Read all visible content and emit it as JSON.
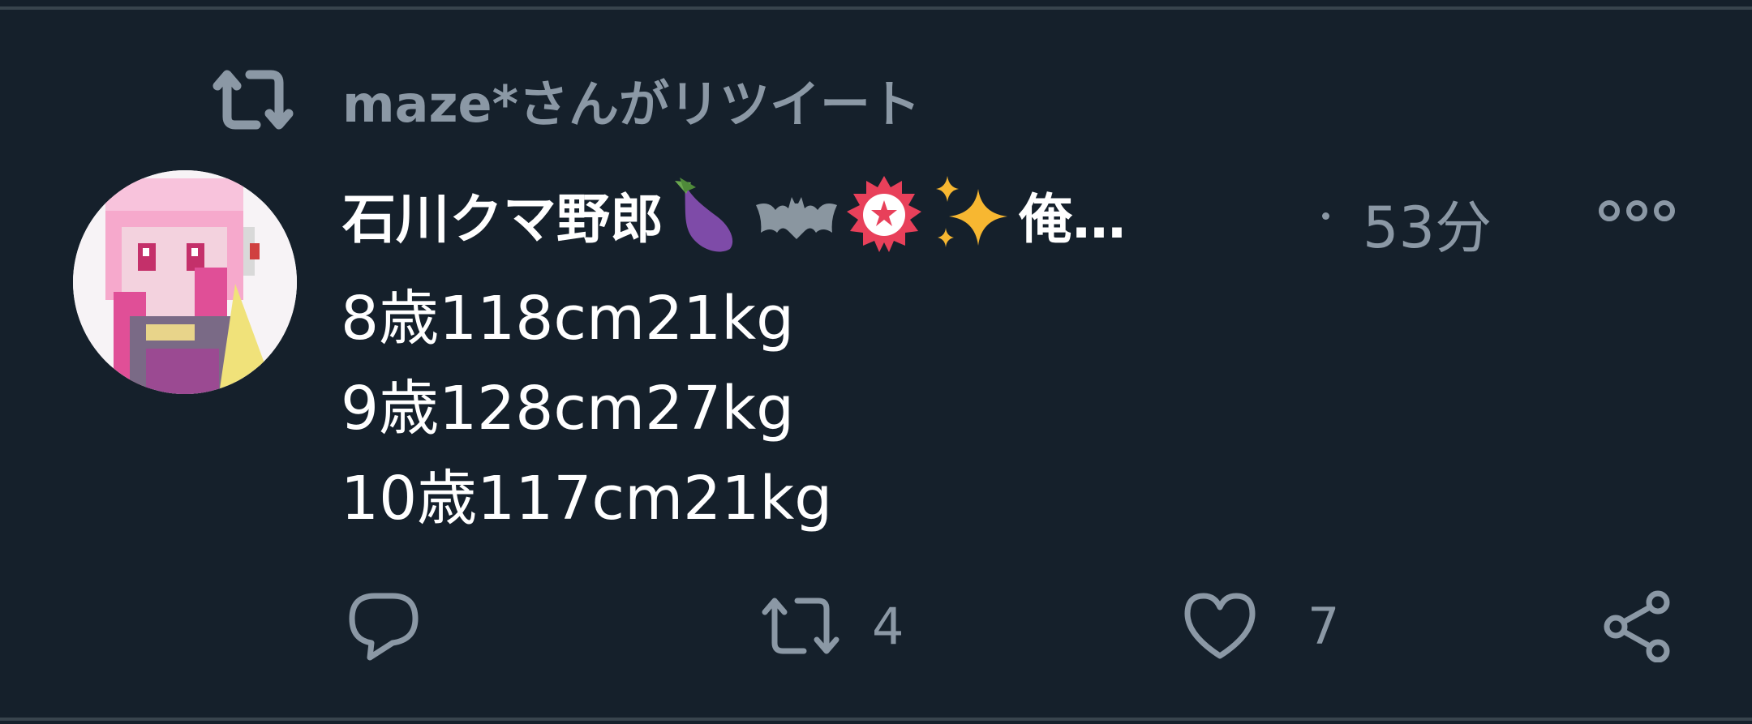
{
  "retweet_context": {
    "label": "maze*さんがリツイート",
    "icon": "retweet-icon"
  },
  "tweet": {
    "author_name": "石川クマ野郎",
    "name_emojis": [
      "eggplant-emoji",
      "bat-emoji",
      "badge-emoji",
      "sparkles-emoji"
    ],
    "name_tail": "俺…",
    "time_ago": "53分",
    "body_lines": [
      "8歳118cm21kg",
      "9歳128cm27kg",
      "10歳117cm21kg"
    ]
  },
  "actions": {
    "reply": {
      "icon": "reply-icon"
    },
    "retweet": {
      "icon": "retweet-icon",
      "count": "4"
    },
    "like": {
      "icon": "heart-icon",
      "count": "7"
    },
    "share": {
      "icon": "share-icon"
    }
  },
  "colors": {
    "background": "#15202b",
    "secondary_text": "#8b98a5",
    "primary_text": "#ffffff",
    "divider": "#38444d"
  }
}
